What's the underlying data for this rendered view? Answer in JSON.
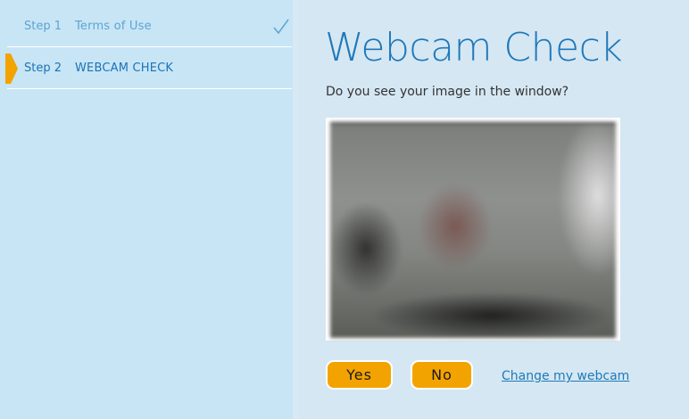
{
  "sidebar": {
    "steps": [
      {
        "number": "Step 1",
        "name": "Terms of Use",
        "status": "completed",
        "icon": "check-icon"
      },
      {
        "number": "Step 2",
        "name": "WEBCAM CHECK",
        "status": "active",
        "icon": "arrow-indicator-icon"
      }
    ]
  },
  "main": {
    "title": "Webcam Check",
    "question": "Do you see your image in the window?",
    "buttons": {
      "yes": "Yes",
      "no": "No"
    },
    "change_link": "Change my webcam"
  },
  "colors": {
    "accent": "#1f78ba",
    "button": "#f3a300",
    "sidebar_bg": "#c8e5f5",
    "main_bg": "#d5e7f3"
  }
}
